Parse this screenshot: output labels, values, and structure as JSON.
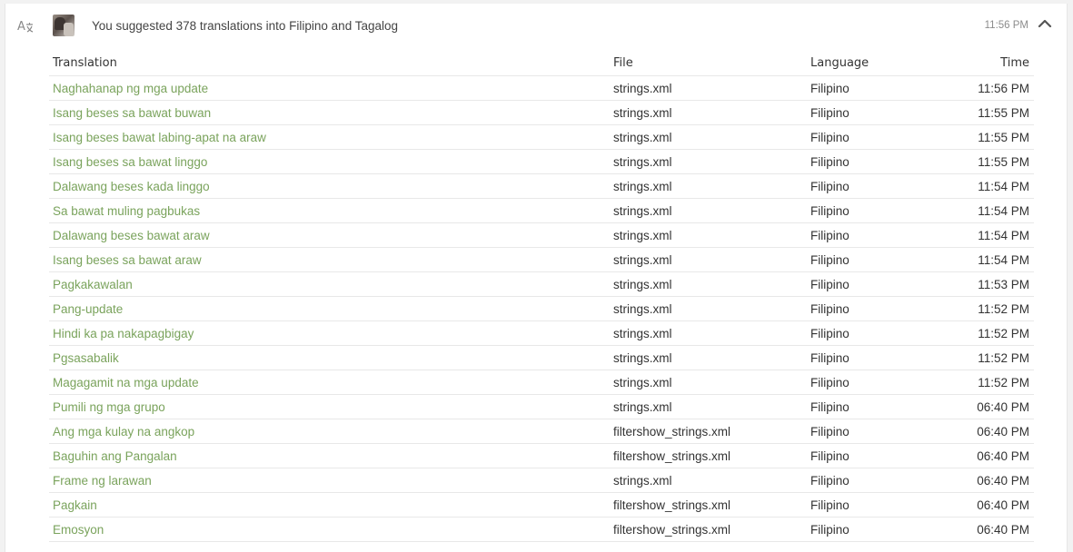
{
  "header": {
    "type_icon": "translate-icon",
    "summary": "You suggested 378 translations into Filipino and Tagalog",
    "time": "11:56 PM",
    "collapse_icon": "chevron-up-icon"
  },
  "table": {
    "columns": [
      "Translation",
      "File",
      "Language",
      "Time"
    ],
    "rows": [
      {
        "translation": "Naghahanap ng mga update",
        "file": "strings.xml",
        "language": "Filipino",
        "time": "11:56 PM"
      },
      {
        "translation": "Isang beses sa bawat buwan",
        "file": "strings.xml",
        "language": "Filipino",
        "time": "11:55 PM"
      },
      {
        "translation": "Isang beses bawat labing-apat na araw",
        "file": "strings.xml",
        "language": "Filipino",
        "time": "11:55 PM"
      },
      {
        "translation": "Isang beses sa bawat linggo",
        "file": "strings.xml",
        "language": "Filipino",
        "time": "11:55 PM"
      },
      {
        "translation": "Dalawang beses kada linggo",
        "file": "strings.xml",
        "language": "Filipino",
        "time": "11:54 PM"
      },
      {
        "translation": "Sa bawat muling pagbukas",
        "file": "strings.xml",
        "language": "Filipino",
        "time": "11:54 PM"
      },
      {
        "translation": "Dalawang beses bawat araw",
        "file": "strings.xml",
        "language": "Filipino",
        "time": "11:54 PM"
      },
      {
        "translation": "Isang beses sa bawat araw",
        "file": "strings.xml",
        "language": "Filipino",
        "time": "11:54 PM"
      },
      {
        "translation": "Pagkakawalan",
        "file": "strings.xml",
        "language": "Filipino",
        "time": "11:53 PM"
      },
      {
        "translation": "Pang-update",
        "file": "strings.xml",
        "language": "Filipino",
        "time": "11:52 PM"
      },
      {
        "translation": "Hindi ka pa nakapagbigay",
        "file": "strings.xml",
        "language": "Filipino",
        "time": "11:52 PM"
      },
      {
        "translation": "Pgsasabalik",
        "file": "strings.xml",
        "language": "Filipino",
        "time": "11:52 PM"
      },
      {
        "translation": "Magagamit na mga update",
        "file": "strings.xml",
        "language": "Filipino",
        "time": "11:52 PM"
      },
      {
        "translation": "Pumili ng mga grupo",
        "file": "strings.xml",
        "language": "Filipino",
        "time": "06:40 PM"
      },
      {
        "translation": "Ang mga kulay na angkop",
        "file": "filtershow_strings.xml",
        "language": "Filipino",
        "time": "06:40 PM"
      },
      {
        "translation": "Baguhin ang Pangalan",
        "file": "filtershow_strings.xml",
        "language": "Filipino",
        "time": "06:40 PM"
      },
      {
        "translation": "Frame ng larawan",
        "file": "strings.xml",
        "language": "Filipino",
        "time": "06:40 PM"
      },
      {
        "translation": "Pagkain",
        "file": "filtershow_strings.xml",
        "language": "Filipino",
        "time": "06:40 PM"
      },
      {
        "translation": "Emosyon",
        "file": "filtershow_strings.xml",
        "language": "Filipino",
        "time": "06:40 PM"
      }
    ]
  },
  "colors": {
    "link": "#7aa35c",
    "text": "#333333",
    "muted": "#8c8c8c",
    "border": "#e8e8e8"
  }
}
